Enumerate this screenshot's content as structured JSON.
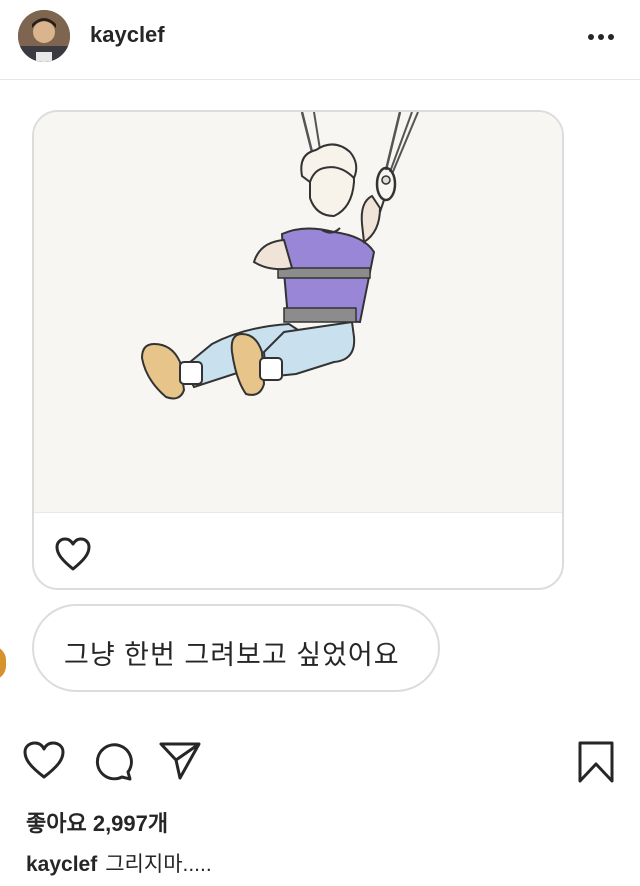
{
  "header": {
    "username": "kayclef",
    "avatar_icon": "profile-avatar",
    "more_icon": "more-options-icon"
  },
  "dm": {
    "image_icon": "illustration-harness-man",
    "like_icon": "heart-icon",
    "message": "그냥 한번 그려보고 싶었어요"
  },
  "actions": {
    "like_icon": "heart-icon",
    "comment_icon": "comment-icon",
    "share_icon": "send-icon",
    "save_icon": "bookmark-icon"
  },
  "likes": {
    "text": "좋아요 2,997개"
  },
  "caption": {
    "username": "kayclef",
    "text": "그리지마....."
  },
  "colors": {
    "border": "#dcdcdc",
    "text": "#262626",
    "shirt": "#9a86d6",
    "jeans": "#c9e0ef"
  }
}
